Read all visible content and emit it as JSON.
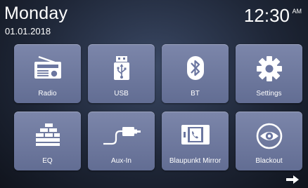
{
  "status": {
    "day": "Monday",
    "date": "01.01.2018",
    "time": "12:30",
    "ampm": "AM"
  },
  "tiles": [
    {
      "label": "Radio",
      "icon": "radio-icon"
    },
    {
      "label": "USB",
      "icon": "usb-icon"
    },
    {
      "label": "BT",
      "icon": "bluetooth-icon"
    },
    {
      "label": "Settings",
      "icon": "gear-icon"
    },
    {
      "label": "EQ",
      "icon": "equalizer-icon"
    },
    {
      "label": "Aux-In",
      "icon": "aux-cable-icon"
    },
    {
      "label": "Blaupunkt Mirror",
      "icon": "phone-mirror-icon"
    },
    {
      "label": "Blackout",
      "icon": "eye-icon"
    }
  ],
  "nav": {
    "next_icon": "right-arrow-icon"
  },
  "colors": {
    "tile": "#6e79a0",
    "background": "#1f2738"
  }
}
